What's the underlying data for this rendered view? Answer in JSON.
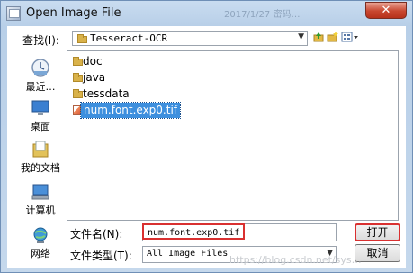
{
  "window": {
    "title": "Open Image File",
    "close_glyph": "✕",
    "watermark_top": "2017/1/27 密码…",
    "watermark_bottom": "https://blog.csdn.net/sys…"
  },
  "look_in": {
    "label": "查找(I):",
    "value": "Tesseract-OCR"
  },
  "places": [
    {
      "label": "最近…",
      "icon": "recent-places-icon"
    },
    {
      "label": "桌面",
      "icon": "desktop-icon"
    },
    {
      "label": "我的文档",
      "icon": "my-documents-icon"
    },
    {
      "label": "计算机",
      "icon": "computer-icon"
    },
    {
      "label": "网络",
      "icon": "network-icon"
    }
  ],
  "files": [
    {
      "name": "doc",
      "type": "folder"
    },
    {
      "name": "java",
      "type": "folder"
    },
    {
      "name": "tessdata",
      "type": "folder"
    },
    {
      "name": "num.font.exp0.tif",
      "type": "tif",
      "selected": true
    }
  ],
  "file_name": {
    "label": "文件名(N):",
    "value": "num.font.exp0.tif"
  },
  "file_type": {
    "label": "文件类型(T):",
    "value": "All Image Files"
  },
  "buttons": {
    "open": "打开",
    "cancel": "取消"
  },
  "colors": {
    "selection": "#3d8fde",
    "highlight_box": "#d93030"
  }
}
